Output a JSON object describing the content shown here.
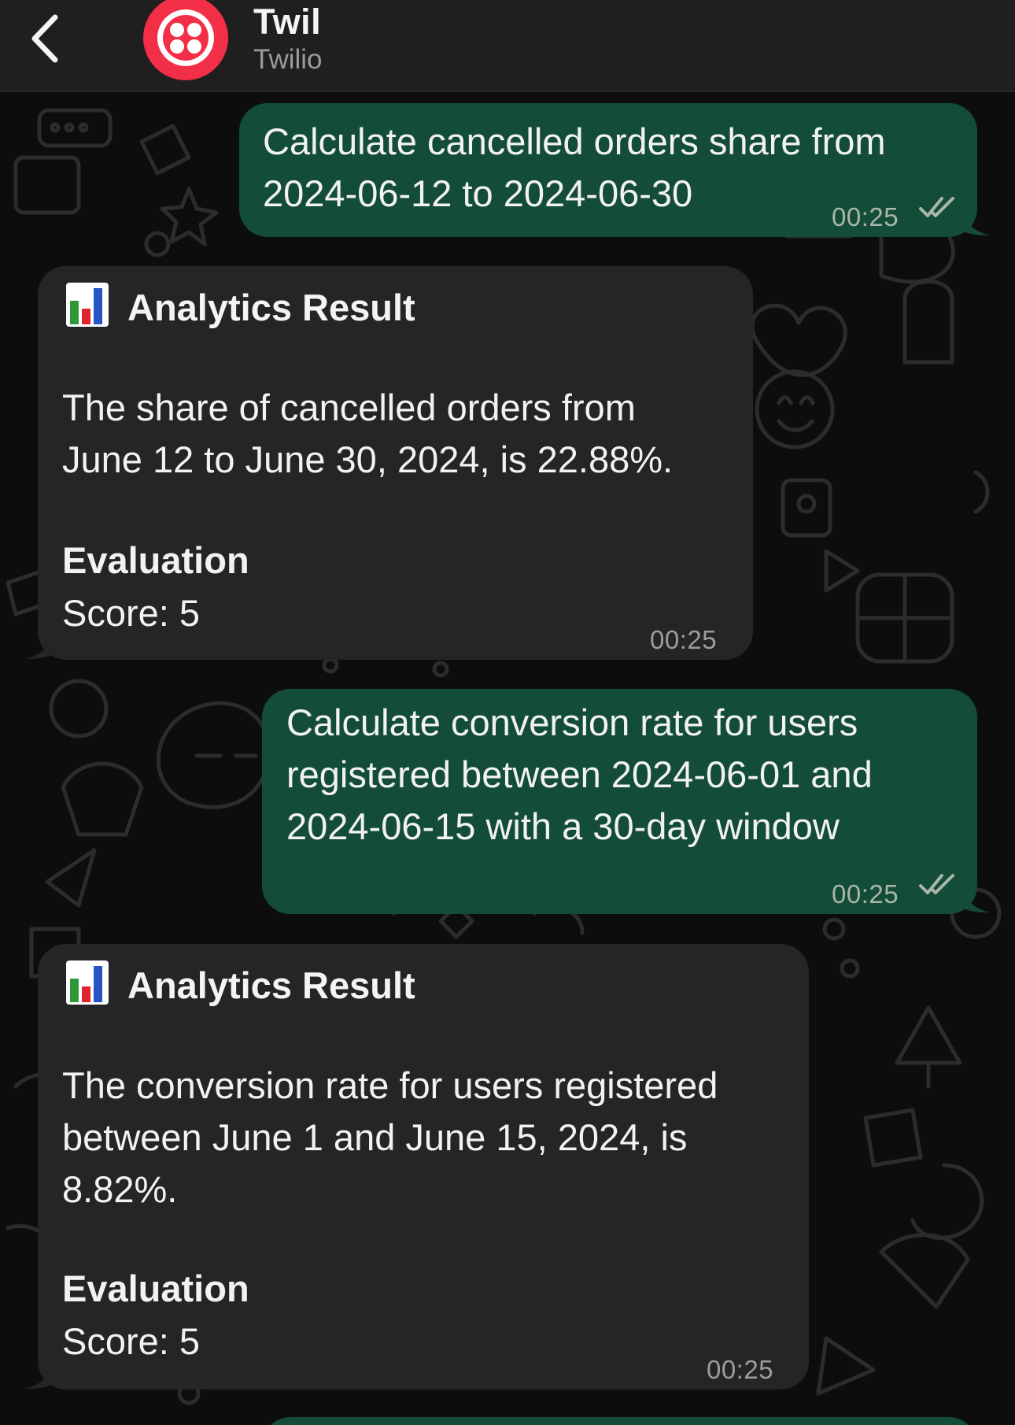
{
  "header": {
    "title": "Twil",
    "subtitle": "Twilio",
    "back_icon": "chevron-left-icon",
    "avatar_icon": "twilio-logo-icon"
  },
  "colors": {
    "outgoing_bubble": "#134d37",
    "incoming_bubble": "#242526",
    "header_bg": "#1f1f1f",
    "twilio_red": "#f22f46"
  },
  "messages": [
    {
      "direction": "outgoing",
      "text": "Calculate cancelled orders share from\n2024-06-12 to 2024-06-30",
      "time": "00:25",
      "status_icon": "double-check-icon"
    },
    {
      "direction": "incoming",
      "icon": "bar-chart-emoji",
      "heading": "Analytics Result",
      "body": "The share of cancelled orders from\nJune 12 to June 30, 2024, is 22.88%.",
      "eval_label": "Evaluation",
      "score": "Score: 5",
      "time": "00:25"
    },
    {
      "direction": "outgoing",
      "text": "Calculate conversion rate for users\nregistered between 2024-06-01 and\n2024-06-15 with a 30-day window",
      "time": "00:25",
      "status_icon": "double-check-icon"
    },
    {
      "direction": "incoming",
      "icon": "bar-chart-emoji",
      "heading": "Analytics Result",
      "body": "The conversion rate for users registered\nbetween June 1 and June 15, 2024, is\n8.82%.",
      "eval_label": "Evaluation",
      "score": "Score: 5",
      "time": "00:25"
    }
  ]
}
